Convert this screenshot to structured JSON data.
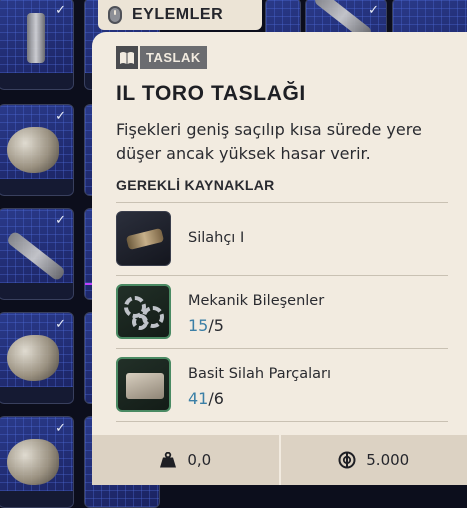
{
  "header": {
    "actions_label": "EYLEMLER",
    "icon": "mouse-icon"
  },
  "inventory": {
    "slot_checkmark": "✓"
  },
  "panel": {
    "badge": {
      "icon": "book-icon",
      "label": "TASLAK"
    },
    "title": "IL TORO TASLAĞI",
    "description": "Fişekleri geniş saçılıp kısa sürede yere düşer ancak yüksek hasar verir.",
    "requirements_header": "GEREKLİ KAYNAKLAR",
    "requirements": [
      {
        "name": "Silahçı I",
        "icon": "weapon-part-icon"
      },
      {
        "name": "Mekanik Bileşenler",
        "have": "15",
        "sep": "/",
        "need": "5",
        "icon": "gears-icon"
      },
      {
        "name": "Basit Silah Parçaları",
        "have": "41",
        "sep": "/",
        "need": "6",
        "icon": "weapon-parts-box-icon"
      }
    ]
  },
  "footer": {
    "weight": {
      "icon": "weight-icon",
      "value": "0,0"
    },
    "price": {
      "icon": "coin-icon",
      "value": "5.000"
    }
  },
  "colors": {
    "panel_bg": "#f2ebe0",
    "count_have": "#3b7fa6",
    "grid_blue": "#2a3a8a",
    "rarity_purple": "#c040ff"
  }
}
